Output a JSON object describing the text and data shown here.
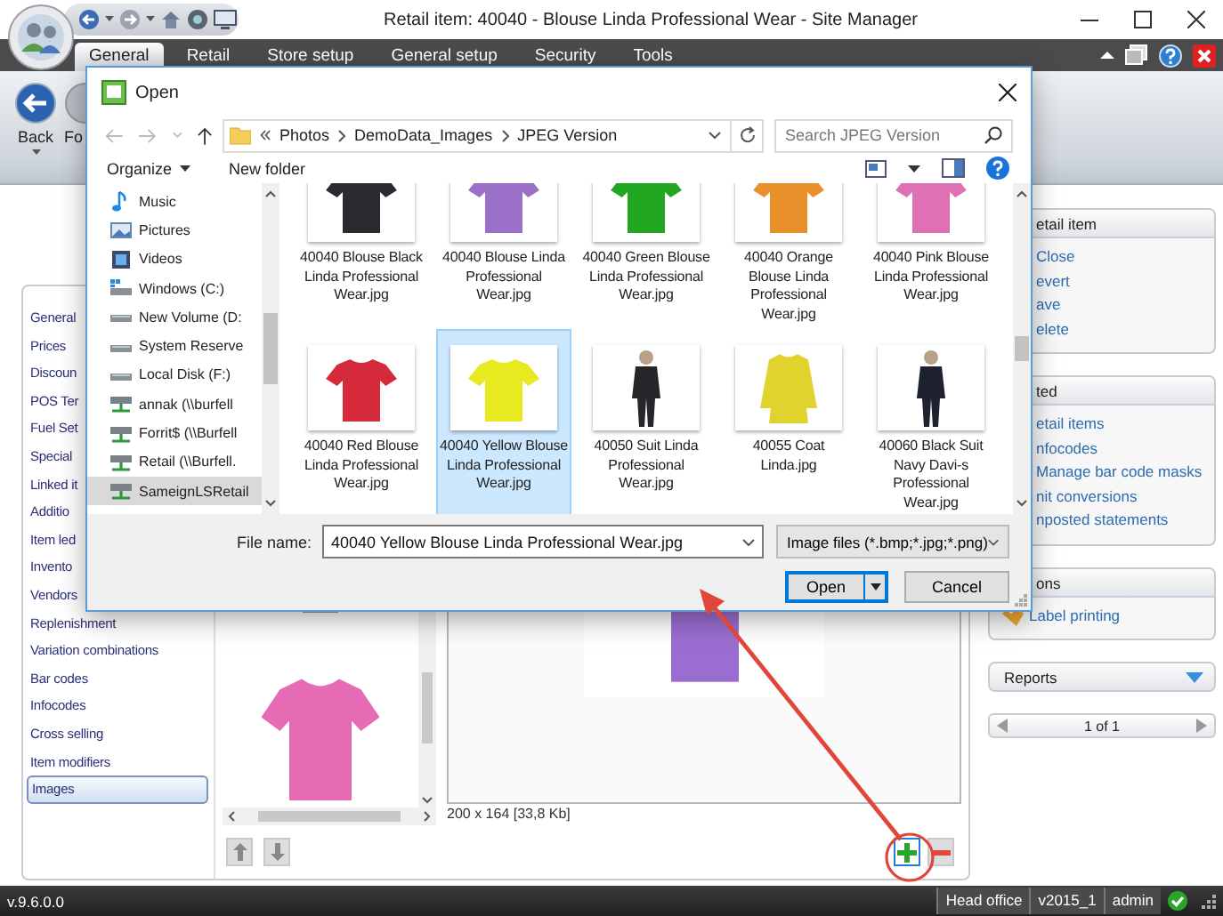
{
  "window": {
    "title": "Retail item: 40040 - Blouse Linda Professional Wear - Site Manager"
  },
  "tabs": [
    {
      "label": "General",
      "selected": true
    },
    {
      "label": "Retail",
      "selected": false
    },
    {
      "label": "Store setup",
      "selected": false
    },
    {
      "label": "General setup",
      "selected": false
    },
    {
      "label": "Security",
      "selected": false
    },
    {
      "label": "Tools",
      "selected": false
    }
  ],
  "ribbon": {
    "back": "Back",
    "forward": "Fo"
  },
  "item_nav": {
    "items": [
      {
        "label": "General",
        "selected": false
      },
      {
        "label": "Prices",
        "selected": false
      },
      {
        "label": "Discoun",
        "selected": false
      },
      {
        "label": "POS Ter",
        "selected": false
      },
      {
        "label": "Fuel Set",
        "selected": false
      },
      {
        "label": "Special",
        "selected": false
      },
      {
        "label": "Linked it",
        "selected": false
      },
      {
        "label": "Additio",
        "selected": false
      },
      {
        "label": "Item led",
        "selected": false
      },
      {
        "label": "Invento",
        "selected": false
      },
      {
        "label": "Vendors",
        "selected": false
      },
      {
        "label": "Replenishment",
        "selected": false
      },
      {
        "label": "Variation combinations",
        "selected": false
      },
      {
        "label": "Bar codes",
        "selected": false
      },
      {
        "label": "Infocodes",
        "selected": false
      },
      {
        "label": "Cross selling",
        "selected": false
      },
      {
        "label": "Item modifiers",
        "selected": false
      },
      {
        "label": "Images",
        "selected": true
      }
    ]
  },
  "images": {
    "preview_info": "200 x 164 [33,8 Kb]"
  },
  "task_pane": {
    "groups": [
      {
        "title": "etail item",
        "links": [
          "Close",
          "evert",
          "ave",
          "elete"
        ]
      },
      {
        "title": "ted",
        "links": [
          "etail items",
          "nfocodes",
          "Manage bar code masks",
          "nit conversions",
          "nposted statements"
        ]
      },
      {
        "title": "ons",
        "links": [
          "Label printing"
        ]
      }
    ],
    "reports": "Reports",
    "pager": "1 of 1"
  },
  "status_bar": {
    "version": "v.9.6.0.0",
    "items": [
      "Head office",
      "v2015_1",
      "admin"
    ]
  },
  "dialog": {
    "title": "Open",
    "path": [
      "Photos",
      "DemoData_Images",
      "JPEG Version"
    ],
    "search": {
      "placeholder": "Search JPEG Version"
    },
    "toolbar": {
      "organize": "Organize",
      "new_folder": "New folder"
    },
    "nav_items": [
      {
        "label": "Music",
        "kind": "music",
        "selected": false
      },
      {
        "label": "Pictures",
        "kind": "pictures",
        "selected": false
      },
      {
        "label": "Videos",
        "kind": "videos",
        "selected": false
      },
      {
        "label": "Windows (C:)",
        "kind": "system-drive",
        "selected": false
      },
      {
        "label": "New Volume (D:",
        "kind": "drive",
        "selected": false
      },
      {
        "label": "System Reserve",
        "kind": "drive",
        "selected": false
      },
      {
        "label": "Local Disk (F:)",
        "kind": "drive",
        "selected": false
      },
      {
        "label": "annak (\\\\burfell",
        "kind": "network-drive",
        "selected": false
      },
      {
        "label": "Forrit$ (\\\\Burfell",
        "kind": "network-drive",
        "selected": false
      },
      {
        "label": "Retail (\\\\Burfell.",
        "kind": "network-drive",
        "selected": false
      },
      {
        "label": "SameignLSRetail",
        "kind": "network-drive",
        "selected": true
      }
    ],
    "files": [
      {
        "name": "40040 Blouse Black Linda Professional Wear.jpg",
        "kind": "shirt",
        "color": "#2a2a30",
        "selected": false
      },
      {
        "name": "40040 Blouse Linda Professional Wear.jpg",
        "kind": "shirt",
        "color": "#9b70c8",
        "selected": false
      },
      {
        "name": "40040 Green Blouse Linda Professional Wear.jpg",
        "kind": "shirt",
        "color": "#22a722",
        "selected": false
      },
      {
        "name": "40040 Orange Blouse Linda Professional Wear.jpg",
        "kind": "shirt",
        "color": "#e8902a",
        "selected": false
      },
      {
        "name": "40040 Pink Blouse Linda Professional Wear.jpg",
        "kind": "shirt",
        "color": "#e070b4",
        "selected": false
      },
      {
        "name": "40040 Red Blouse Linda Professional Wear.jpg",
        "kind": "shirt",
        "color": "#d42a3c",
        "selected": false
      },
      {
        "name": "40040 Yellow Blouse Linda Professional Wear.jpg",
        "kind": "shirt",
        "color": "#e6ea1e",
        "selected": true
      },
      {
        "name": "40050 Suit Linda Professional Wear.jpg",
        "kind": "person",
        "color": "#26262a",
        "selected": false
      },
      {
        "name": "40055 Coat Linda.jpg",
        "kind": "coat",
        "color": "#e2d22e",
        "selected": false
      },
      {
        "name": "40060 Black Suit Navy Davi-s Professional Wear.jpg",
        "kind": "person",
        "color": "#1e2230",
        "selected": false
      }
    ],
    "file_name": {
      "label": "File name:",
      "value": "40040 Yellow Blouse Linda Professional Wear.jpg"
    },
    "file_type": "Image files (*.bmp;*.jpg;*.png)",
    "buttons": {
      "open": "Open",
      "cancel": "Cancel"
    }
  }
}
